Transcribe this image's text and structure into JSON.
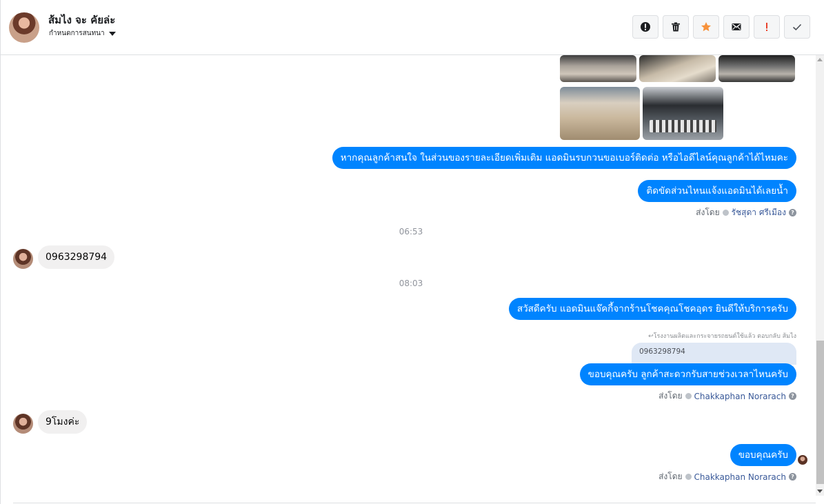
{
  "header": {
    "contact_name": "ส้มไง จะ คัยล่ะ",
    "subtitle": "กำหนดการสนทนา",
    "toolbar": {
      "spam_icon": "exclamation-circle-icon",
      "delete_icon": "trash-icon",
      "star_icon": "star-icon",
      "mark_unread_icon": "envelope-icon",
      "important_icon": "exclamation-icon",
      "done_icon": "checkmark-icon"
    }
  },
  "colors": {
    "accent": "#0084ff",
    "star": "#f7923b",
    "important": "#e9412b"
  },
  "messages": {
    "out_1": "หากคุณลูกค้าสนใจ ในส่วนของรายละเอียดเพิ่มเติม แอดมินรบกวนขอเบอร์ติดต่อ หรือไอดีไลน์คุณลูกค้าได้ไหมคะ",
    "out_2": "ติดขัดส่วนไหนแจ้งแอดมินได้เลยน้ำ",
    "sent_by_1_label": "ส่งโดย",
    "sent_by_1_name": "รัชสุดา ศรีเมือง",
    "time_1": "06:53",
    "in_1": "0963298794",
    "time_2": "08:03",
    "out_3": "สวัสดีครับ แอดมินแจ๊คกี้จากร้านโชคคุณโชคอุดร ยินดีให้บริการครับ",
    "reply_hint": "โรงงานผลิตและกระจายรถยนต์ใช้แล้ว ตอบกลับ ส้มไง",
    "reply_quote": "0963298794",
    "out_4": "ขอบคุณครับ ลูกค้าสะดวกรับสายช่วงเวลาไหนครับ",
    "sent_by_2_label": "ส่งโดย",
    "sent_by_2_name": "Chakkaphan Norarach",
    "in_2": "9โมงค่ะ",
    "out_5": "ขอบคุณครับ",
    "sent_by_3_label": "ส่งโดย",
    "sent_by_3_name": "Chakkaphan Norarach"
  }
}
